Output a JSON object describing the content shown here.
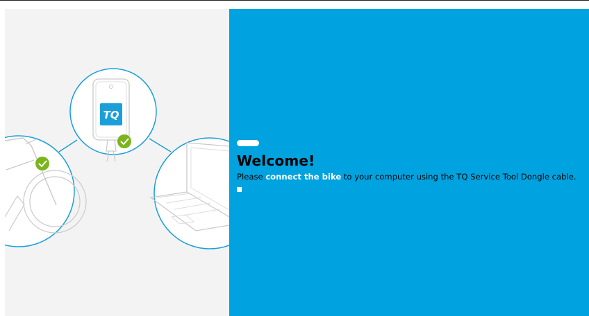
{
  "welcome": {
    "title": "Welcome!",
    "text_before": "Please ",
    "text_emphasis": "connect the bike",
    "text_after": " to your computer using the TQ Service Tool Dongle cable."
  },
  "illustration": {
    "logo_text": "TQ",
    "icons": [
      "bike-icon",
      "dongle-icon",
      "laptop-icon",
      "checkmark-icon"
    ]
  },
  "colors": {
    "accent_blue": "#00a3e0",
    "check_green": "#7ab51d",
    "panel_grey": "#f3f3f3"
  }
}
